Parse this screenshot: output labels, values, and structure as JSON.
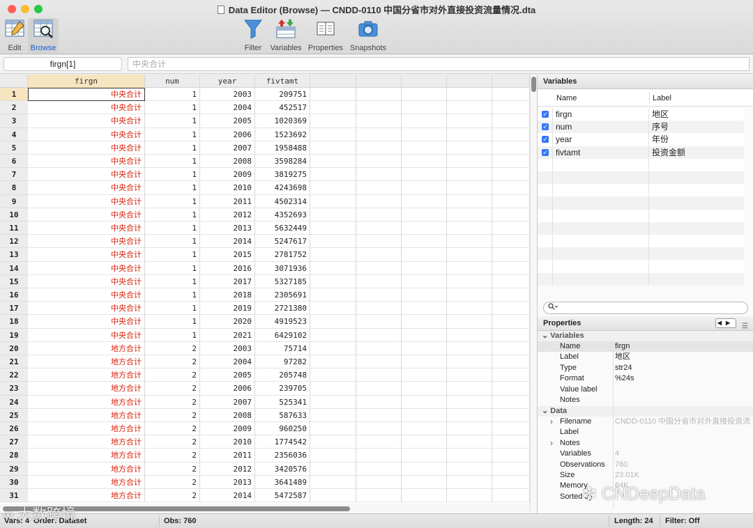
{
  "window": {
    "title": "Data Editor (Browse) — CNDD-0110 中国分省市对外直接投资流量情况.dta"
  },
  "toolbar": {
    "edit": "Edit",
    "browse": "Browse",
    "filter": "Filter",
    "variables": "Variables",
    "properties": "Properties",
    "snapshots": "Snapshots"
  },
  "cell": {
    "ref": "firgn[1]",
    "value": "中央合计"
  },
  "grid": {
    "columns": [
      "firgn",
      "num",
      "year",
      "fivtamt"
    ],
    "rows": [
      {
        "n": "1",
        "firgn": "中央合计",
        "num": "1",
        "year": "2003",
        "fivtamt": "209751"
      },
      {
        "n": "2",
        "firgn": "中央合计",
        "num": "1",
        "year": "2004",
        "fivtamt": "452517"
      },
      {
        "n": "3",
        "firgn": "中央合计",
        "num": "1",
        "year": "2005",
        "fivtamt": "1020369"
      },
      {
        "n": "4",
        "firgn": "中央合计",
        "num": "1",
        "year": "2006",
        "fivtamt": "1523692"
      },
      {
        "n": "5",
        "firgn": "中央合计",
        "num": "1",
        "year": "2007",
        "fivtamt": "1958488"
      },
      {
        "n": "6",
        "firgn": "中央合计",
        "num": "1",
        "year": "2008",
        "fivtamt": "3598284"
      },
      {
        "n": "7",
        "firgn": "中央合计",
        "num": "1",
        "year": "2009",
        "fivtamt": "3819275"
      },
      {
        "n": "8",
        "firgn": "中央合计",
        "num": "1",
        "year": "2010",
        "fivtamt": "4243698"
      },
      {
        "n": "9",
        "firgn": "中央合计",
        "num": "1",
        "year": "2011",
        "fivtamt": "4502314"
      },
      {
        "n": "10",
        "firgn": "中央合计",
        "num": "1",
        "year": "2012",
        "fivtamt": "4352693"
      },
      {
        "n": "11",
        "firgn": "中央合计",
        "num": "1",
        "year": "2013",
        "fivtamt": "5632449"
      },
      {
        "n": "12",
        "firgn": "中央合计",
        "num": "1",
        "year": "2014",
        "fivtamt": "5247617"
      },
      {
        "n": "13",
        "firgn": "中央合计",
        "num": "1",
        "year": "2015",
        "fivtamt": "2781752"
      },
      {
        "n": "14",
        "firgn": "中央合计",
        "num": "1",
        "year": "2016",
        "fivtamt": "3071936"
      },
      {
        "n": "15",
        "firgn": "中央合计",
        "num": "1",
        "year": "2017",
        "fivtamt": "5327185"
      },
      {
        "n": "16",
        "firgn": "中央合计",
        "num": "1",
        "year": "2018",
        "fivtamt": "2305691"
      },
      {
        "n": "17",
        "firgn": "中央合计",
        "num": "1",
        "year": "2019",
        "fivtamt": "2721380"
      },
      {
        "n": "18",
        "firgn": "中央合计",
        "num": "1",
        "year": "2020",
        "fivtamt": "4919523"
      },
      {
        "n": "19",
        "firgn": "中央合计",
        "num": "1",
        "year": "2021",
        "fivtamt": "6429102"
      },
      {
        "n": "20",
        "firgn": "地方合计",
        "num": "2",
        "year": "2003",
        "fivtamt": "75714"
      },
      {
        "n": "21",
        "firgn": "地方合计",
        "num": "2",
        "year": "2004",
        "fivtamt": "97282"
      },
      {
        "n": "22",
        "firgn": "地方合计",
        "num": "2",
        "year": "2005",
        "fivtamt": "205748"
      },
      {
        "n": "23",
        "firgn": "地方合计",
        "num": "2",
        "year": "2006",
        "fivtamt": "239705"
      },
      {
        "n": "24",
        "firgn": "地方合计",
        "num": "2",
        "year": "2007",
        "fivtamt": "525341"
      },
      {
        "n": "25",
        "firgn": "地方合计",
        "num": "2",
        "year": "2008",
        "fivtamt": "587633"
      },
      {
        "n": "26",
        "firgn": "地方合计",
        "num": "2",
        "year": "2009",
        "fivtamt": "960250"
      },
      {
        "n": "27",
        "firgn": "地方合计",
        "num": "2",
        "year": "2010",
        "fivtamt": "1774542"
      },
      {
        "n": "28",
        "firgn": "地方合计",
        "num": "2",
        "year": "2011",
        "fivtamt": "2356036"
      },
      {
        "n": "29",
        "firgn": "地方合计",
        "num": "2",
        "year": "2012",
        "fivtamt": "3420576"
      },
      {
        "n": "30",
        "firgn": "地方合计",
        "num": "2",
        "year": "2013",
        "fivtamt": "3641489"
      },
      {
        "n": "31",
        "firgn": "地方合计",
        "num": "2",
        "year": "2014",
        "fivtamt": "5472587"
      }
    ]
  },
  "variables": {
    "title": "Variables",
    "col_name": "Name",
    "col_label": "Label",
    "items": [
      {
        "name": "firgn",
        "label": "地区"
      },
      {
        "name": "num",
        "label": "序号"
      },
      {
        "name": "year",
        "label": "年份"
      },
      {
        "name": "fivtamt",
        "label": "投资金额"
      }
    ],
    "search_icon": "magnifier-icon"
  },
  "properties": {
    "title": "Properties",
    "variables_section": "Variables",
    "variables": [
      {
        "k": "Name",
        "v": "firgn"
      },
      {
        "k": "Label",
        "v": "地区"
      },
      {
        "k": "Type",
        "v": "str24"
      },
      {
        "k": "Format",
        "v": "%24s"
      },
      {
        "k": "Value label",
        "v": ""
      },
      {
        "k": "Notes",
        "v": ""
      }
    ],
    "data_section": "Data",
    "data": [
      {
        "k": "Filename",
        "v": "CNDD-0110 中国分省市对外直接投资流"
      },
      {
        "k": "Label",
        "v": ""
      },
      {
        "k": "Notes",
        "v": ""
      },
      {
        "k": "Variables",
        "v": "4"
      },
      {
        "k": "Observations",
        "v": "760"
      },
      {
        "k": "Size",
        "v": "23.01K"
      },
      {
        "k": "Memory",
        "v": "64K"
      },
      {
        "k": "Sorted by",
        "v": ""
      }
    ]
  },
  "status": {
    "vars": "Vars: 4",
    "order": "Order: Dataset",
    "obs": "Obs: 760",
    "length": "Length: 24",
    "filter": "Filter: Off"
  },
  "watermarks": {
    "left": "大数跨境",
    "right": "CNDeepData"
  },
  "colors": {
    "string_cell": "#d81e06",
    "checkbox": "#3478f6",
    "close": "#ff5f57",
    "minimize": "#febc2e",
    "zoom": "#28c840"
  }
}
